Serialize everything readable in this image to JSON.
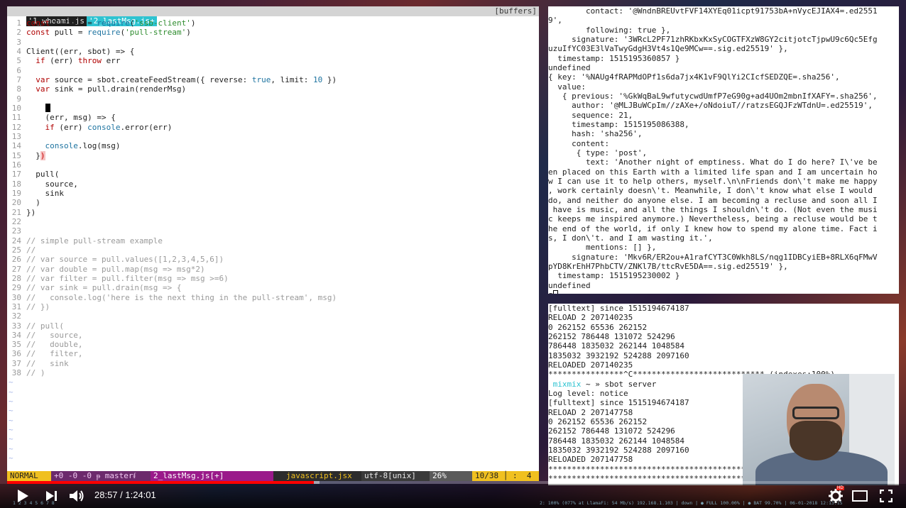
{
  "vim": {
    "tabs": [
      {
        "label": "'1_whoami.js"
      },
      {
        "label": "'2_lastMsg.js+"
      }
    ],
    "buffers_label": "[buffers]",
    "status": {
      "mode": "NORMAL",
      "git": "+0 -0 -0 ᵽ masterᵮ",
      "file": "2_lastMsg.js[+]",
      "filetype": "javascript.jsx",
      "encoding": "utf-8[unix]",
      "percent": "26%",
      "position": "10/38 │ :  4"
    },
    "code_lines": [
      [
        {
          "t": "const ",
          "c": "kw"
        },
        {
          "t": "Client = ",
          "c": "plain"
        },
        {
          "t": "require",
          "c": "fn"
        },
        {
          "t": "(",
          "c": "plain"
        },
        {
          "t": "'ssb-client'",
          "c": "str"
        },
        {
          "t": ")",
          "c": "plain"
        }
      ],
      [
        {
          "t": "const ",
          "c": "kw"
        },
        {
          "t": "pull = ",
          "c": "plain"
        },
        {
          "t": "require",
          "c": "fn"
        },
        {
          "t": "(",
          "c": "plain"
        },
        {
          "t": "'pull-stream'",
          "c": "str"
        },
        {
          "t": ")",
          "c": "plain"
        }
      ],
      [],
      [
        {
          "t": "Client((err, sbot) => {",
          "c": "plain"
        }
      ],
      [
        {
          "t": "  if ",
          "c": "kw"
        },
        {
          "t": "(err) ",
          "c": "plain"
        },
        {
          "t": "throw ",
          "c": "kw"
        },
        {
          "t": "err",
          "c": "plain"
        }
      ],
      [],
      [
        {
          "t": "  var ",
          "c": "kw"
        },
        {
          "t": "source = sbot.createFeedStream({ reverse: ",
          "c": "plain"
        },
        {
          "t": "true",
          "c": "bool"
        },
        {
          "t": ", limit: ",
          "c": "plain"
        },
        {
          "t": "10",
          "c": "num"
        },
        {
          "t": " })",
          "c": "plain"
        }
      ],
      [
        {
          "t": "  var ",
          "c": "kw"
        },
        {
          "t": "sink = pull.drain(renderMsg)",
          "c": "plain"
        }
      ],
      [],
      [
        {
          "t": "    ",
          "c": "plain"
        },
        {
          "t": "",
          "c": "cursor"
        }
      ],
      [
        {
          "t": "    (err, msg) => {",
          "c": "plain"
        }
      ],
      [
        {
          "t": "    if ",
          "c": "kw"
        },
        {
          "t": "(err) ",
          "c": "plain"
        },
        {
          "t": "console",
          "c": "fn"
        },
        {
          "t": ".error(err)",
          "c": "plain"
        }
      ],
      [],
      [
        {
          "t": "    console",
          "c": "fn"
        },
        {
          "t": ".log(msg)",
          "c": "plain"
        }
      ],
      [
        {
          "t": "  }",
          "c": "plain"
        },
        {
          "t": ")",
          "c": "paren-hl"
        }
      ],
      [],
      [
        {
          "t": "  pull(",
          "c": "plain"
        }
      ],
      [
        {
          "t": "    source,",
          "c": "plain"
        }
      ],
      [
        {
          "t": "    sink",
          "c": "plain"
        }
      ],
      [
        {
          "t": "  )",
          "c": "plain"
        }
      ],
      [
        {
          "t": "})",
          "c": "plain"
        }
      ],
      [],
      [],
      [
        {
          "t": "// simple pull-stream example",
          "c": "cm"
        }
      ],
      [
        {
          "t": "//",
          "c": "cm"
        }
      ],
      [
        {
          "t": "// var source = pull.values([1,2,3,4,5,6])",
          "c": "cm"
        }
      ],
      [
        {
          "t": "// var double = pull.map(msg => msg*2)",
          "c": "cm"
        }
      ],
      [
        {
          "t": "// var filter = pull.filter(msg => msg >=6)",
          "c": "cm"
        }
      ],
      [
        {
          "t": "// var sink = pull.drain(msg => {",
          "c": "cm"
        }
      ],
      [
        {
          "t": "//   console.log('here is the next thing in the pull-stream', msg)",
          "c": "cm"
        }
      ],
      [
        {
          "t": "// })",
          "c": "cm"
        }
      ],
      [],
      [
        {
          "t": "// pull(",
          "c": "cm"
        }
      ],
      [
        {
          "t": "//   source,",
          "c": "cm"
        }
      ],
      [
        {
          "t": "//   double,",
          "c": "cm"
        }
      ],
      [
        {
          "t": "//   filter,",
          "c": "cm"
        }
      ],
      [
        {
          "t": "//   sink",
          "c": "cm"
        }
      ],
      [
        {
          "t": "// )",
          "c": "cm"
        }
      ]
    ],
    "tilde_count": 9
  },
  "terminal_top": {
    "lines": [
      "        contact: '@WndnBREUvtFVF14XYEq01icpt91753bA+nVycEJIAX4=.ed25519',",
      "        following: true },",
      "     signature: '3WRcL2PF71zhRKbxKxSyCOGTFXzW8GY2citjotcTjpwU9c6Qc5EfguzuIfYC03E3lVaTwyGdgH3Vt4s1Qe9MCw==.sig.ed25519' },",
      "  timestamp: 1515195360857 }",
      "undefined",
      "{ key: '%NAUg4fRAPMdOPf1s6da7jx4K1vF9QlYi2CIcfSEDZQE=.sha256',",
      "  value:",
      "   { previous: '%GkWqBaL9wfutycwdUmfP7eG90g+ad4UOm2mbnIfXAFY=.sha256',",
      "     author: '@MLJBuWCpIm//zAXe+/oNdoiuT//ratzsEGQJFzWTdnU=.ed25519',",
      "     sequence: 21,",
      "     timestamp: 1515195086388,",
      "     hash: 'sha256',",
      "     content:",
      "      { type: 'post',",
      "        text: 'Another night of emptiness. What do I do here? I\\'ve been placed on this Earth with a limited life span and I am uncertain how I can use it to help others, myself.\\n\\nFriends don\\'t make me happy, work certainly doesn\\'t. Meanwhile, I don\\'t know what else I would do, and neither do anyone else. I am becoming a recluse and soon all I have is music, and all the things I shouldn\\'t do. (Not even the music keeps me inspired anymore.) Nevertheless, being a recluse would be the end of the world, if only I knew how to spend my alone time. Fact is, I don\\'t. and I am wasting it.',",
      "        mentions: [] },",
      "     signature: 'Mkv6R/ER2ou+A1rafCYT3C0Wkh8LS/nqg1IDBCyiEB+8RLX6qFMwVpYD8KrEhH7PhbCTV/ZNKl7B/ttcRvE5DA==.sig.ed25519' },",
      "  timestamp: 1515195230002 }",
      "undefined",
      "q"
    ]
  },
  "terminal_bottom": {
    "lines_before": [
      "[fulltext] since 1515194674187",
      "RELOAD 2 207140235",
      "0 262152 65536 262152",
      "262152 786448 131072 524296",
      "786448 1835032 262144 1048584",
      "1835032 3932192 524288 2097160",
      "RELOADED 207140235",
      "****************^C**************************** (indexes:100%)"
    ],
    "prompt_user": " mixmix",
    "prompt_rest": " ~ » sbot server",
    "lines_after": [
      "Log level: notice",
      "[fulltext] since 1515194674187",
      "RELOAD 2 207147758",
      "0 262152 65536 262152",
      "262152 786448 131072 524296",
      "786448 1835032 262144 1048584",
      "1835032 3932192 524288 2097160",
      "RELOADED 207147758",
      "*****************************************************************",
      "*****************************************************************"
    ]
  },
  "player": {
    "time": "28:57 / 1:24:01",
    "progress_fraction": 0.344,
    "hd_badge": "HD",
    "icons": [
      "play-icon",
      "next-icon",
      "volume-icon",
      "settings-icon",
      "theater-mode-icon",
      "fullscreen-icon"
    ]
  },
  "system_bar": {
    "workspaces": "1 2 3 4 5 6 7 8",
    "status": "2: 100% (077% at LlamaFi: 54 Mb/s) 192.168.1.103 | down | ● FULL 100.00% | ● BAT 99.70% | 06-01-2018 12:13:15"
  },
  "colors": {
    "tab_active": "#2ec3d1",
    "mode_bg": "#f0c020",
    "file_bg": "#9a1a8a",
    "progress": "#ff0000"
  }
}
